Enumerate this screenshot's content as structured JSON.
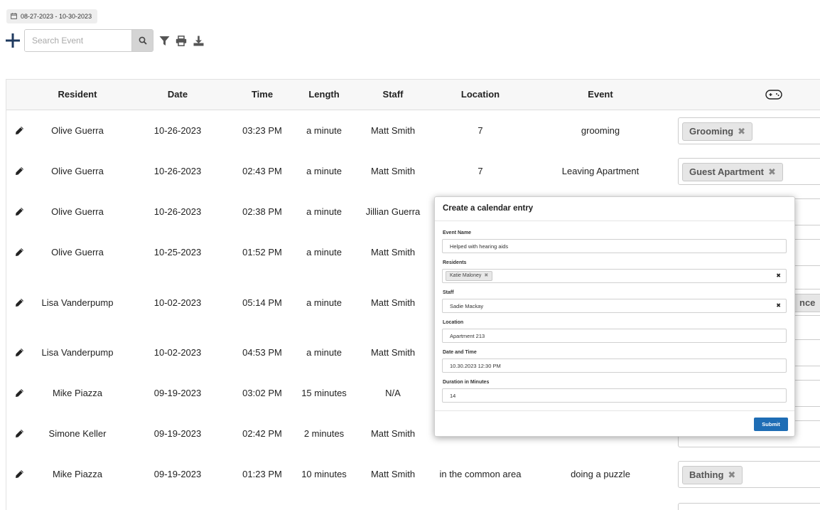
{
  "date_range": "08-27-2023 - 10-30-2023",
  "search": {
    "placeholder": "Search Event"
  },
  "table": {
    "headers": [
      "Resident",
      "Date",
      "Time",
      "Length",
      "Staff",
      "Location",
      "Event"
    ],
    "rows": [
      {
        "resident": "Olive Guerra",
        "date": "10-26-2023",
        "time": "03:23 PM",
        "length": "a minute",
        "staff": "Matt Smith",
        "location": "7",
        "event": "grooming",
        "tag": "Grooming"
      },
      {
        "resident": "Olive Guerra",
        "date": "10-26-2023",
        "time": "02:43 PM",
        "length": "a minute",
        "staff": "Matt Smith",
        "location": "7",
        "event": "Leaving Apartment",
        "tag": "Guest Apartment"
      },
      {
        "resident": "Olive Guerra",
        "date": "10-26-2023",
        "time": "02:38 PM",
        "length": "a minute",
        "staff": "Jillian Guerra",
        "location": "",
        "event": "",
        "tag": ""
      },
      {
        "resident": "Olive Guerra",
        "date": "10-25-2023",
        "time": "01:52 PM",
        "length": "a minute",
        "staff": "Matt Smith",
        "location": "",
        "event": "",
        "tag": ""
      },
      {
        "resident": "Lisa Vanderpump",
        "date": "10-02-2023",
        "time": "05:14 PM",
        "length": "a minute",
        "staff": "Matt Smith",
        "location": "",
        "event": "",
        "tag": "nce"
      },
      {
        "resident": "Lisa Vanderpump",
        "date": "10-02-2023",
        "time": "04:53 PM",
        "length": "a minute",
        "staff": "Matt Smith",
        "location": "",
        "event": "",
        "tag": ""
      },
      {
        "resident": "Mike Piazza",
        "date": "09-19-2023",
        "time": "03:02 PM",
        "length": "15 minutes",
        "staff": "N/A",
        "location": "",
        "event": "",
        "tag": ""
      },
      {
        "resident": "Simone Keller",
        "date": "09-19-2023",
        "time": "02:42 PM",
        "length": "2 minutes",
        "staff": "Matt Smith",
        "location": "",
        "event": "",
        "tag": ""
      },
      {
        "resident": "Mike Piazza",
        "date": "09-19-2023",
        "time": "01:23 PM",
        "length": "10 minutes",
        "staff": "Matt Smith",
        "location": "in the common area",
        "event": "doing a puzzle",
        "tag": "Bathing"
      }
    ]
  },
  "modal": {
    "title": "Create a calendar entry",
    "event_name_label": "Event Name",
    "event_name_value": "Helped with hearing aids",
    "residents_label": "Residents",
    "residents_tag": "Katie Maloney",
    "staff_label": "Staff",
    "staff_value": "Sadie Mackay",
    "location_label": "Location",
    "location_value": "Apartment 213",
    "datetime_label": "Date and Time",
    "datetime_value": "10.30.2023 12:30 PM",
    "duration_label": "Duration in Minutes",
    "duration_value": "14",
    "submit_label": "Submit"
  },
  "colors": {
    "primary": "#1e6db5",
    "icon_dark": "#1f3a5f",
    "tag_bg": "#e6e6e6"
  }
}
